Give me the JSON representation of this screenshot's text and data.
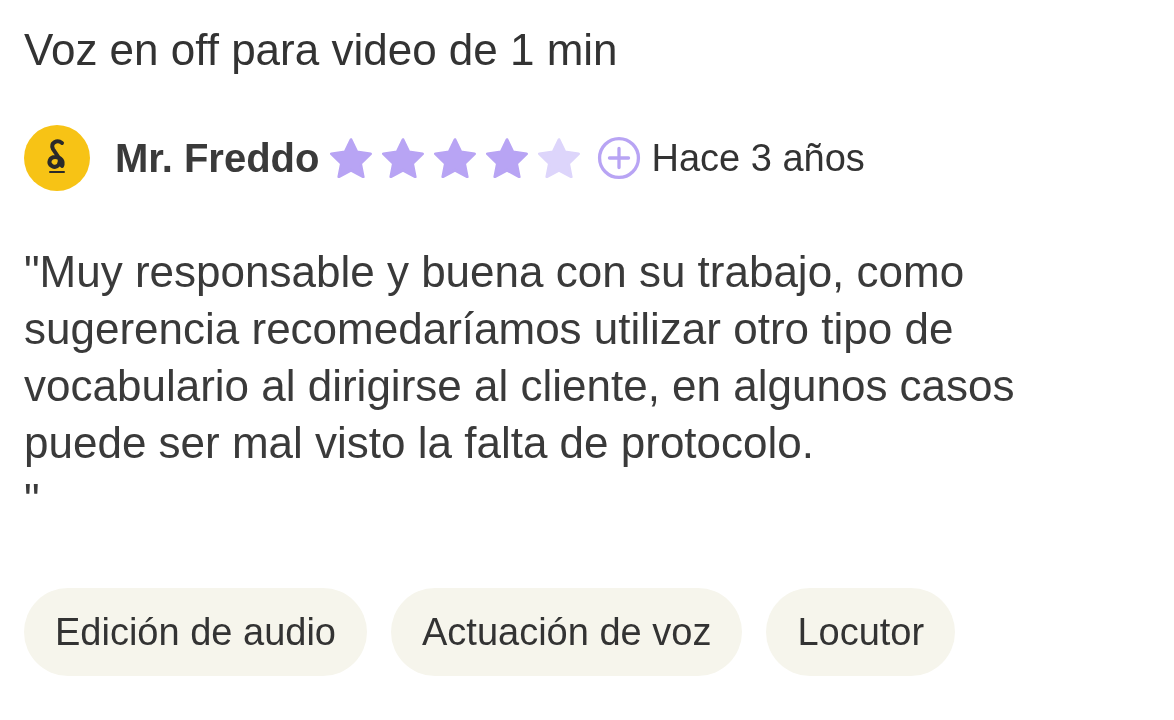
{
  "review": {
    "title": "Voz en off para video de 1 min",
    "author": {
      "name": "Mr. Freddo",
      "stars": 4
    },
    "time": "Hace 3 años",
    "text": "\"Muy responsable y buena con su trabajo, como sugerencia recomedaríamos utilizar otro tipo de vocabulario al dirigirse al cliente, en algunos casos puede ser mal visto la falta de protocolo.\n\"",
    "tags": [
      "Edición de audio",
      "Actuación de voz",
      "Locutor"
    ]
  }
}
